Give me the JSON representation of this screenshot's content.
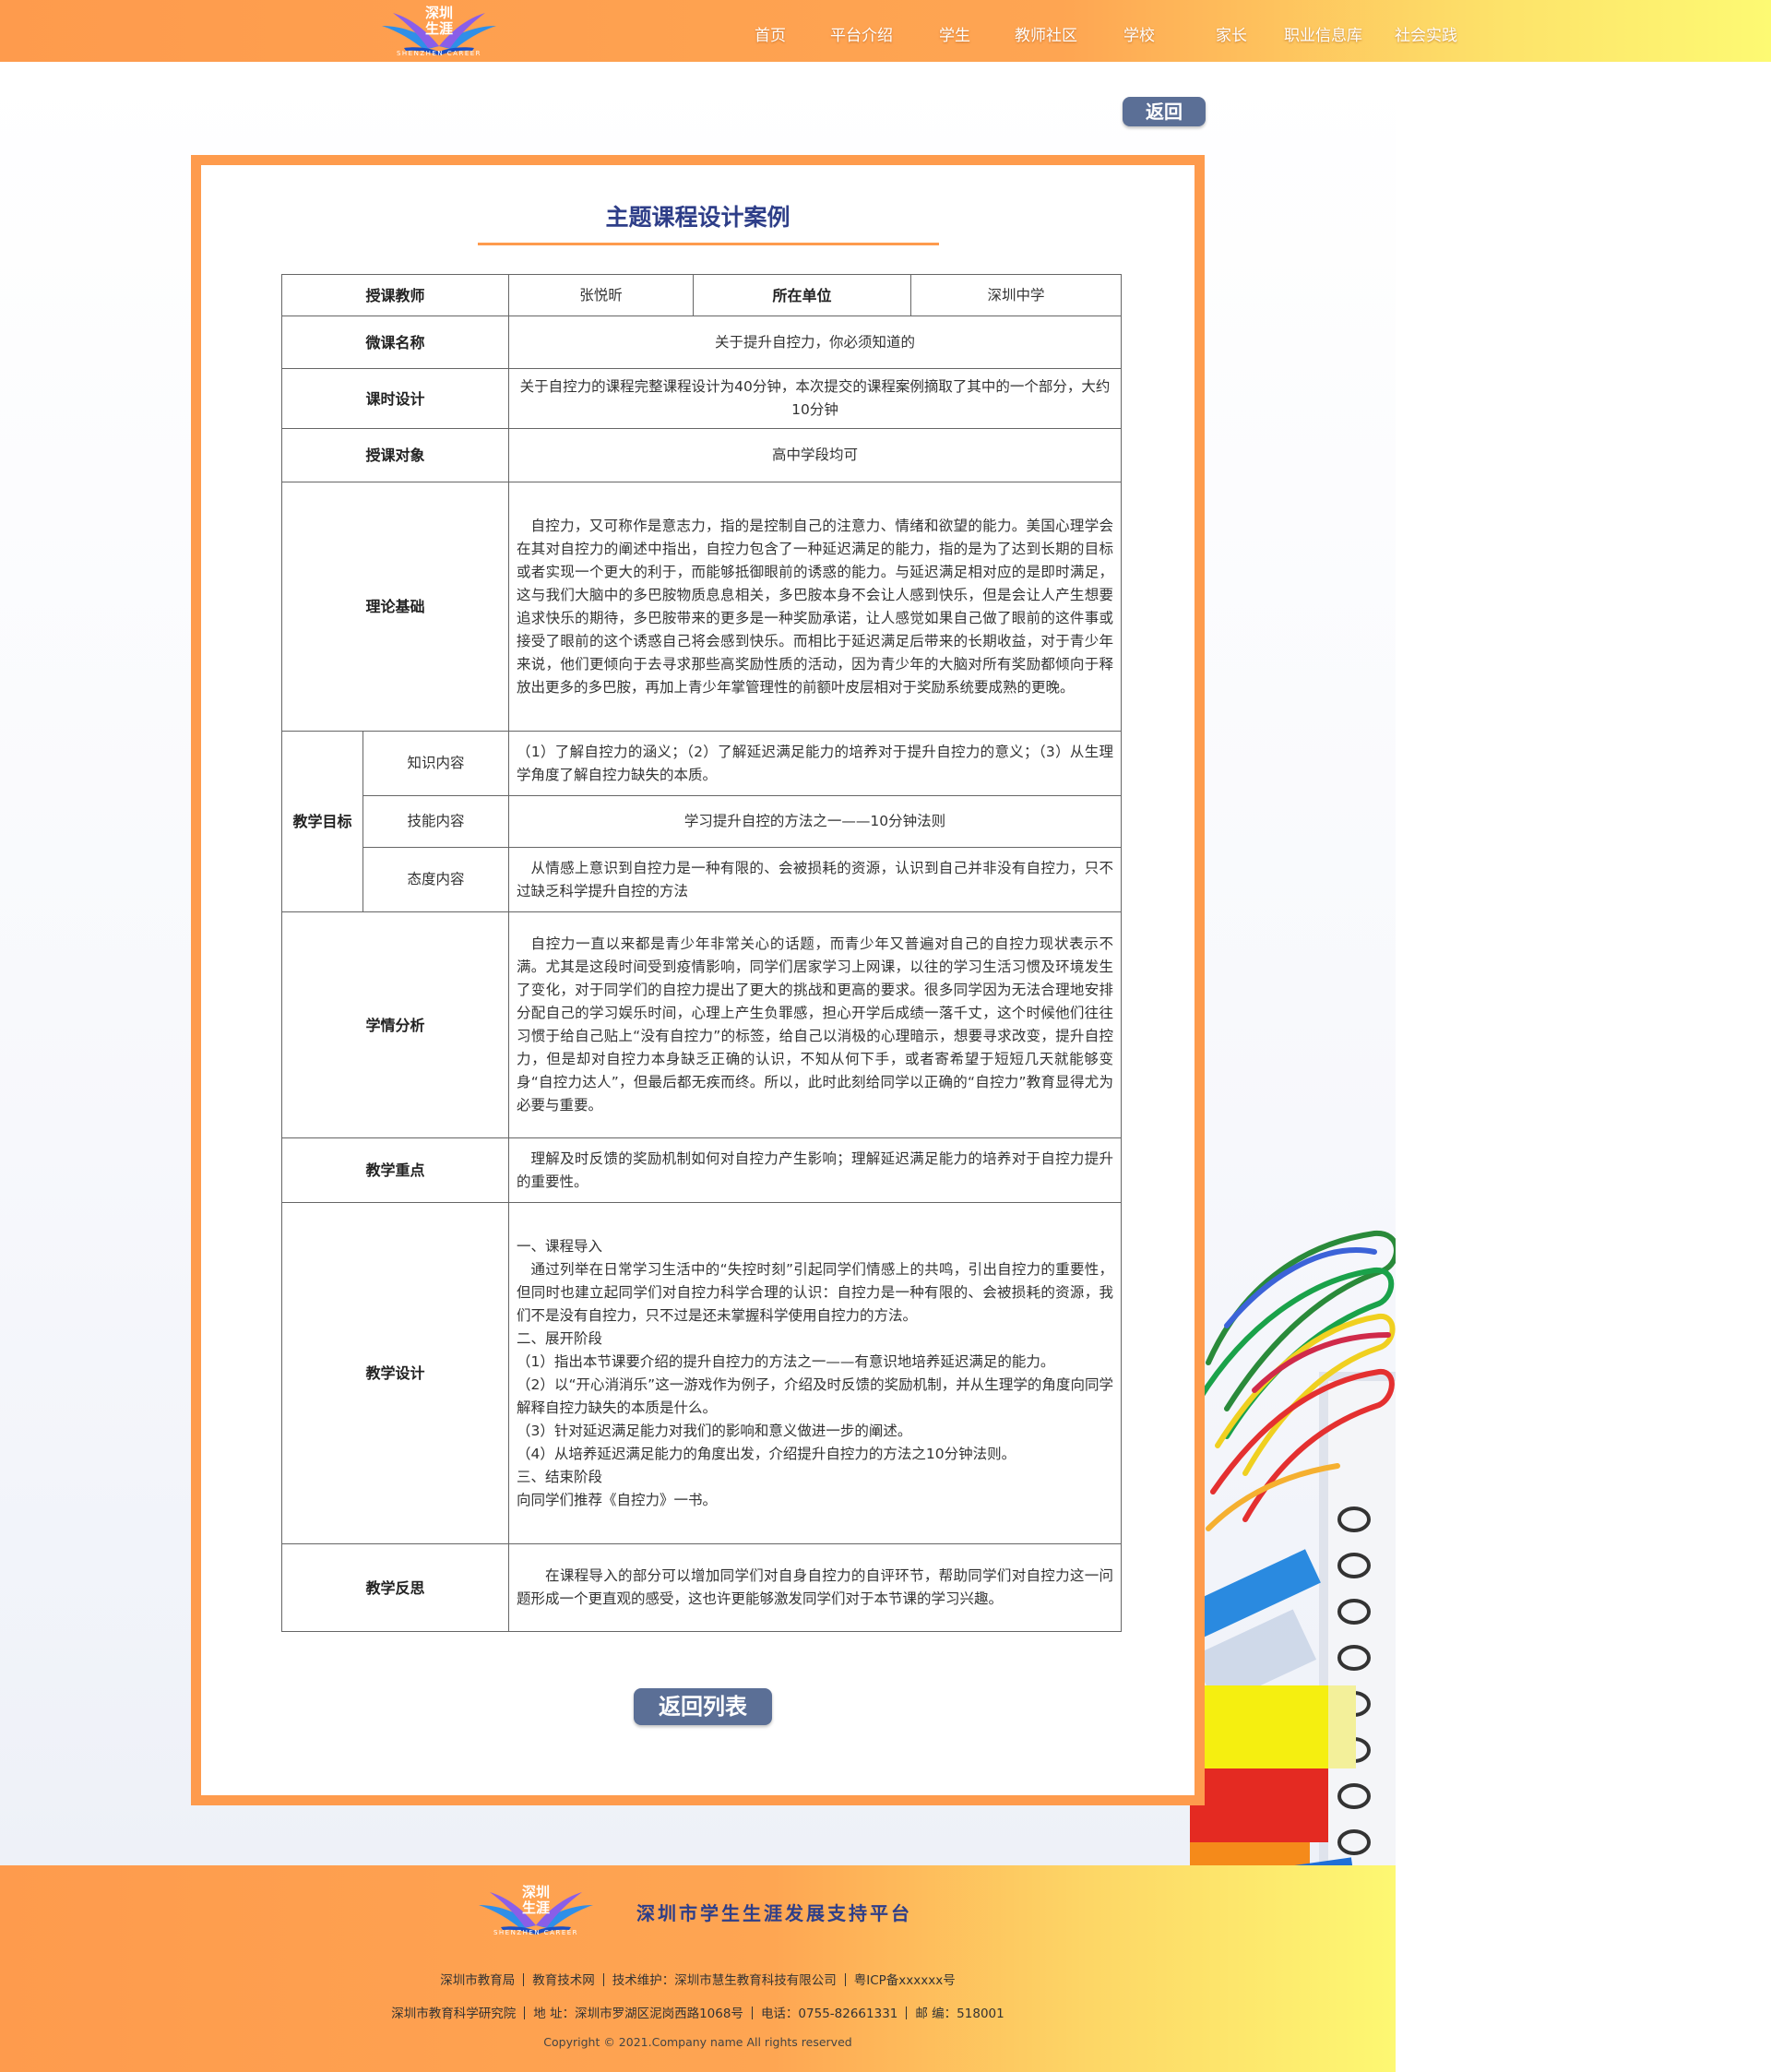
{
  "header": {
    "logo": {
      "line1": "深圳",
      "line2": "生涯",
      "line3": "SHENZHEN CAREER"
    },
    "nav": [
      "首页",
      "平台介绍",
      "学生",
      "教师社区",
      "学校",
      "家长",
      "职业信息库",
      "社会实践"
    ]
  },
  "page": {
    "back_label": "返回",
    "title": "主题课程设计案例",
    "back_list_label": "返回列表"
  },
  "lesson": {
    "teacher_label": "授课教师",
    "teacher": "张悦昕",
    "unit_label": "所在单位",
    "unit": "深圳中学",
    "name_label": "微课名称",
    "name": "关于提升自控力，你必须知道的",
    "time_label": "课时设计",
    "time": "关于自控力的课程完整课程设计为40分钟，本次提交的课程案例摘取了其中的一个部分，大约10分钟",
    "audience_label": "授课对象",
    "audience": "高中学段均可",
    "theory_label": "理论基础",
    "theory": "自控力，又可称作是意志力，指的是控制自己的注意力、情绪和欲望的能力。美国心理学会在其对自控力的阐述中指出，自控力包含了一种延迟满足的能力，指的是为了达到长期的目标或者实现一个更大的利于，而能够抵御眼前的诱惑的能力。与延迟满足相对应的是即时满足，这与我们大脑中的多巴胺物质息息相关，多巴胺本身不会让人感到快乐，但是会让人产生想要追求快乐的期待，多巴胺带来的更多是一种奖励承诺，让人感觉如果自己做了眼前的这件事或接受了眼前的这个诱惑自己将会感到快乐。而相比于延迟满足后带来的长期收益，对于青少年来说，他们更倾向于去寻求那些高奖励性质的活动，因为青少年的大脑对所有奖励都倾向于释放出更多的多巴胺，再加上青少年掌管理性的前额叶皮层相对于奖励系统要成熟的更晚。",
    "goal_label": "教学目标",
    "knowledge_label": "知识内容",
    "knowledge": "（1）了解自控力的涵义；（2）了解延迟满足能力的培养对于提升自控力的意义；（3）从生理学角度了解自控力缺失的本质。",
    "skill_label": "技能内容",
    "skill": "学习提升自控的方法之一——10分钟法则",
    "attitude_label": "态度内容",
    "attitude": "从情感上意识到自控力是一种有限的、会被损耗的资源，认识到自己并非没有自控力，只不过缺乏科学提升自控的方法",
    "analysis_label": "学情分析",
    "analysis": "自控力一直以来都是青少年非常关心的话题，而青少年又普遍对自己的自控力现状表示不满。尤其是这段时间受到疫情影响，同学们居家学习上网课，以往的学习生活习惯及环境发生了变化，对于同学们的自控力提出了更大的挑战和更高的要求。很多同学因为无法合理地安排分配自己的学习娱乐时间，心理上产生负罪感，担心开学后成绩一落千丈，这个时候他们往往习惯于给自己贴上“没有自控力”的标签，给自己以消极的心理暗示，想要寻求改变，提升自控力，但是却对自控力本身缺乏正确的认识，不知从何下手，或者寄希望于短短几天就能够变身“自控力达人”，但最后都无疾而终。所以，此时此刻给同学以正确的“自控力”教育显得尤为必要与重要。",
    "focus_label": "教学重点",
    "focus": "理解及时反馈的奖励机制如何对自控力产生影响；理解延迟满足能力的培养对于自控力提升的重要性。",
    "design_label": "教学设计",
    "design": [
      "一、课程导入",
      "通过列举在日常学习生活中的“失控时刻”引起同学们情感上的共鸣，引出自控力的重要性，但同时也建立起同学们对自控力科学合理的认识：自控力是一种有限的、会被损耗的资源，我们不是没有自控力，只不过是还未掌握科学使用自控力的方法。",
      "二、展开阶段",
      "（1）指出本节课要介绍的提升自控力的方法之一——有意识地培养延迟满足的能力。",
      "（2）以“开心消消乐”这一游戏作为例子，介绍及时反馈的奖励机制，并从生理学的角度向同学解释自控力缺失的本质是什么。",
      "（3）针对延迟满足能力对我们的影响和意义做进一步的阐述。",
      "（4）从培养延迟满足能力的角度出发，介绍提升自控力的方法之10分钟法则。",
      "三、结束阶段",
      "向同学们推荐《自控力》一书。"
    ],
    "reflection_label": "教学反思",
    "reflection": "在课程导入的部分可以增加同学们对自身自控力的自评环节，帮助同学们对自控力这一问题形成一个更直观的感受，这也许更能够激发同学们对于本节课的学习兴趣。"
  },
  "footer": {
    "platform": "深圳市学生生涯发展支持平台",
    "row1": [
      "深圳市教育局",
      "教育技术网",
      "技术维护：深圳市慧生教育科技有限公司",
      "粤ICP备xxxxxx号"
    ],
    "row2": [
      "深圳市教育科学研究院",
      "地  址：深圳市罗湖区泥岗西路1068号",
      "电话：0755-82661331",
      "邮  编：518001"
    ],
    "copyright": "Copyright © 2021.Company name All rights reserved"
  },
  "colors": {
    "orange": "#fe9b4d",
    "yellow": "#fdfa73",
    "navy_title": "#2e3e88",
    "button": "#5b6f96"
  }
}
